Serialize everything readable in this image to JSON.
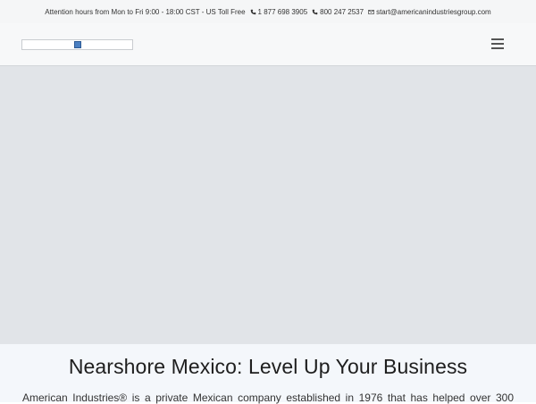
{
  "topbar": {
    "hours": "Attention hours from Mon to Fri 9:00 - 18:00 CST - US Toll Free",
    "phone1": "1 877 698 3905",
    "phone2": "800 247 2537",
    "email": "start@americanindustriesgroup.com"
  },
  "hero": {
    "title": "Nearshore Mexico: Level Up Your Business",
    "intro": "American Industries® is a private Mexican company established in 1976 that has helped over 300"
  },
  "colors": {
    "topbar_bg": "#f5f6f7",
    "hero_placeholder": "#e1e4e8",
    "section_bg": "#f4f7fb"
  }
}
